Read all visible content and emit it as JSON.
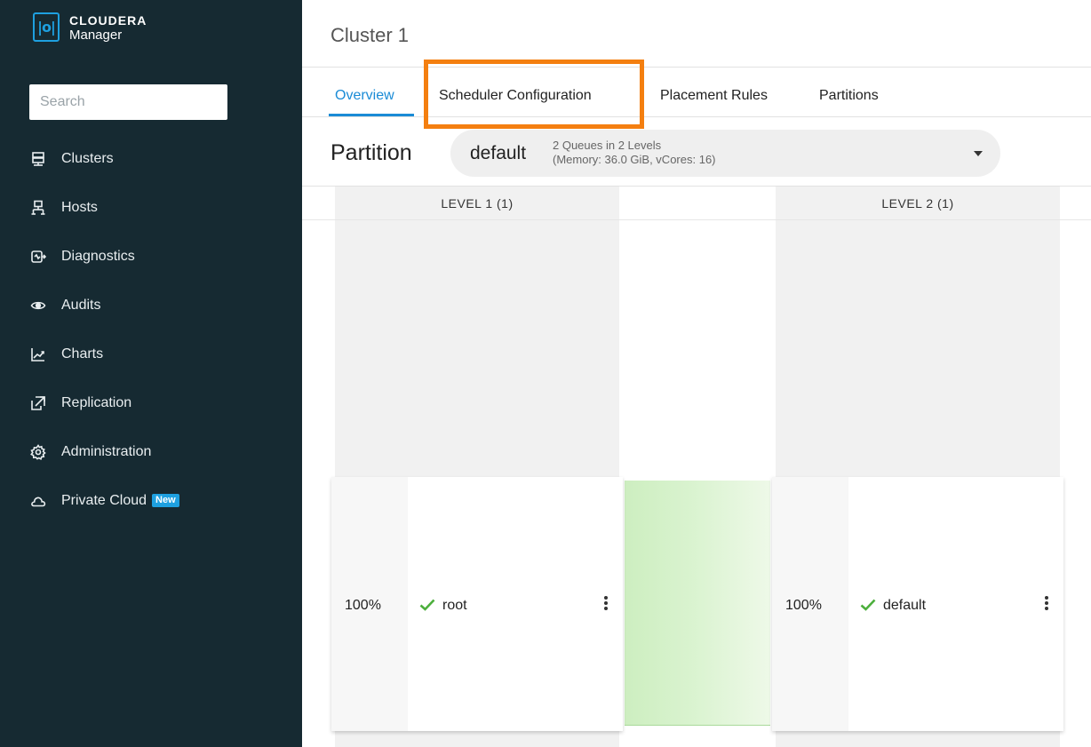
{
  "sidebar": {
    "brand_name": "CLOUDERA",
    "brand_sub": "Manager",
    "brand_logo": "|o|",
    "search_placeholder": "Search",
    "items": [
      {
        "label": "Clusters",
        "icon": "server-icon"
      },
      {
        "label": "Hosts",
        "icon": "hosts-icon"
      },
      {
        "label": "Diagnostics",
        "icon": "diagnostics-icon"
      },
      {
        "label": "Audits",
        "icon": "eye-icon"
      },
      {
        "label": "Charts",
        "icon": "line-chart-icon"
      },
      {
        "label": "Replication",
        "icon": "replication-icon"
      },
      {
        "label": "Administration",
        "icon": "gear-icon"
      },
      {
        "label": "Private Cloud",
        "icon": "cloud-icon",
        "badge": "New"
      }
    ]
  },
  "header": {
    "title": "Cluster 1",
    "tabs": [
      {
        "label": "Overview",
        "active": true
      },
      {
        "label": "Scheduler Configuration",
        "highlighted": true
      },
      {
        "label": "Placement Rules"
      },
      {
        "label": "Partitions"
      }
    ]
  },
  "partition": {
    "label": "Partition",
    "selected": "default",
    "info_line1": "2 Queues in 2 Levels",
    "info_line2": "(Memory: 36.0 GiB, vCores: 16)"
  },
  "levels": [
    {
      "header": "LEVEL 1 (1)",
      "queue": {
        "percent": "100%",
        "name": "root",
        "status": "check-icon"
      }
    },
    {
      "header": "LEVEL 2 (1)",
      "queue": {
        "percent": "100%",
        "name": "default",
        "status": "check-icon"
      }
    }
  ],
  "colors": {
    "sidebar_bg": "#162a32",
    "accent": "#1a8bd6",
    "highlight_box": "#f47f10",
    "status_ok": "#4caf3c",
    "connector": "#cdeec0"
  }
}
